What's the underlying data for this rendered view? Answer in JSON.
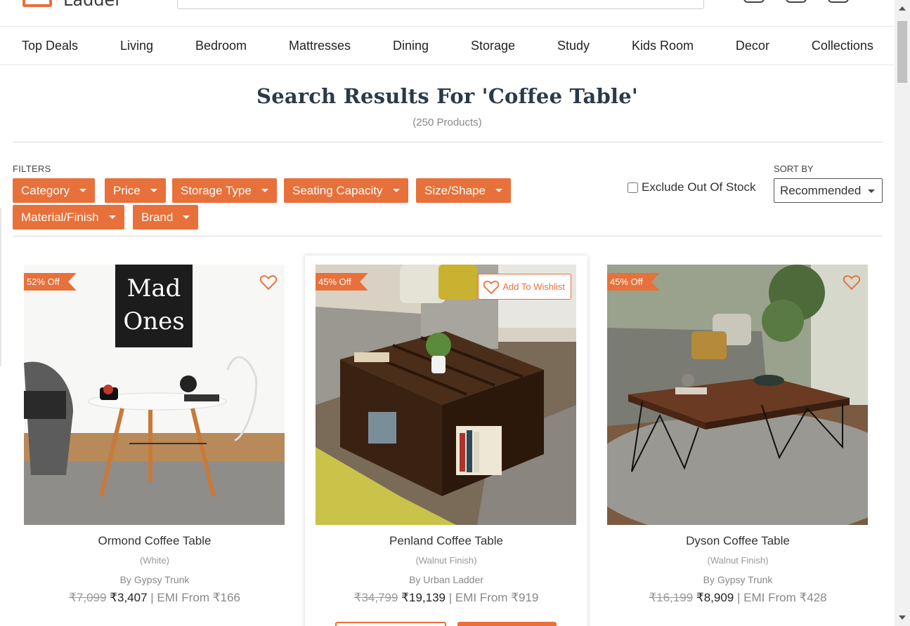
{
  "header": {
    "logo_text": "Ladder"
  },
  "nav": {
    "items": [
      "Top Deals",
      "Living",
      "Bedroom",
      "Mattresses",
      "Dining",
      "Storage",
      "Study",
      "Kids Room",
      "Decor",
      "Collections"
    ]
  },
  "search": {
    "title": "Search Results For 'Coffee Table'",
    "count": "(250 Products)"
  },
  "filters": {
    "label": "FILTERS",
    "chips": [
      "Category",
      "Price",
      "Storage Type",
      "Seating Capacity",
      "Size/Shape",
      "Material/Finish",
      "Brand"
    ],
    "exclude_label": "Exclude Out Of Stock",
    "exclude_checked": false
  },
  "sort": {
    "label": "SORT BY",
    "selected": "Recommended"
  },
  "products": [
    {
      "discount": "52% Off",
      "name": "Ormond Coffee Table",
      "finish": "(White)",
      "brand": "By Gypsy Trunk",
      "mrp": "₹7,099",
      "price": "₹3,407",
      "emi": "| EMI From ₹166"
    },
    {
      "discount": "45% Off",
      "name": "Penland Coffee Table",
      "finish": "(Walnut Finish)",
      "brand": "By Urban Ladder",
      "mrp": "₹34,799",
      "price": "₹19,139",
      "emi": "| EMI From ₹919",
      "wishlist_label": "Add To Wishlist"
    },
    {
      "discount": "45% Off",
      "name": "Dyson Coffee Table",
      "finish": "(Walnut Finish)",
      "brand": "By Gypsy Trunk",
      "mrp": "₹16,199",
      "price": "₹8,909",
      "emi": "| EMI From ₹428"
    }
  ],
  "colors": {
    "accent": "#e8703a",
    "title": "#2b3a4a"
  }
}
